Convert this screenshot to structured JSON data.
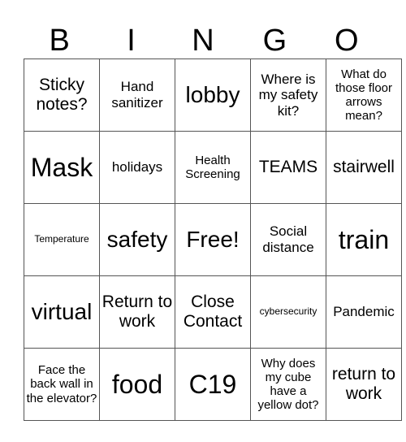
{
  "header": {
    "letters": [
      "B",
      "I",
      "N",
      "G",
      "O"
    ]
  },
  "grid": [
    [
      {
        "text": "Sticky notes?",
        "size": "l"
      },
      {
        "text": "Hand sanitizer",
        "size": "m"
      },
      {
        "text": "lobby",
        "size": "xl"
      },
      {
        "text": "Where is my safety kit?",
        "size": "m"
      },
      {
        "text": "What do those floor arrows mean?",
        "size": "s"
      }
    ],
    [
      {
        "text": "Mask",
        "size": "xxl"
      },
      {
        "text": "holidays",
        "size": "m"
      },
      {
        "text": "Health Screening",
        "size": "s"
      },
      {
        "text": "TEAMS",
        "size": "l"
      },
      {
        "text": "stairwell",
        "size": "l"
      }
    ],
    [
      {
        "text": "Temperature",
        "size": "xs"
      },
      {
        "text": "safety",
        "size": "xl"
      },
      {
        "text": "Free!",
        "size": "xl"
      },
      {
        "text": "Social distance",
        "size": "m"
      },
      {
        "text": "train",
        "size": "xxl"
      }
    ],
    [
      {
        "text": "virtual",
        "size": "xl"
      },
      {
        "text": "Return to work",
        "size": "l"
      },
      {
        "text": "Close Contact",
        "size": "l"
      },
      {
        "text": "cybersecurity",
        "size": "xs"
      },
      {
        "text": "Pandemic",
        "size": "m"
      }
    ],
    [
      {
        "text": "Face the back wall in the elevator?",
        "size": "s"
      },
      {
        "text": "food",
        "size": "xxl"
      },
      {
        "text": "C19",
        "size": "xxl"
      },
      {
        "text": "Why does my cube have a yellow dot?",
        "size": "s"
      },
      {
        "text": "return to work",
        "size": "l"
      }
    ]
  ]
}
